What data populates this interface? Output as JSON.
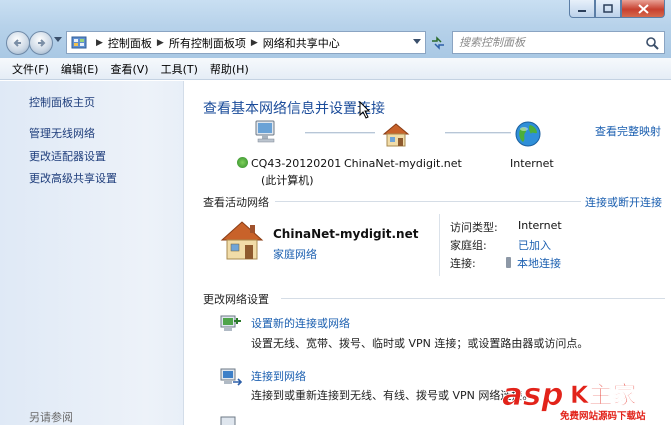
{
  "address": {
    "crumbs": [
      "控制面板",
      "所有控制面板项",
      "网络和共享中心"
    ],
    "search_placeholder": "搜索控制面板"
  },
  "menu": [
    "文件(F)",
    "编辑(E)",
    "查看(V)",
    "工具(T)",
    "帮助(H)"
  ],
  "sidebar": {
    "links": [
      "控制面板主页",
      "管理无线网络",
      "更改适配器设置",
      "更改高级共享设置"
    ],
    "see_also": "另请参阅"
  },
  "main": {
    "heading": "查看基本网络信息并设置连接",
    "view_full_map": "查看完整映射",
    "network_map": {
      "computer_name": "CQ43-20120201",
      "computer_sub": "(此计算机)",
      "network_name": "ChinaNet-mydigit.net",
      "internet": "Internet"
    },
    "active": {
      "header": "查看活动网络",
      "connect_disconnect": "连接或断开连接",
      "network_name": "ChinaNet-mydigit.net",
      "network_type": "家庭网络",
      "access_type_label": "访问类型:",
      "access_type_value": "Internet",
      "homegroup_label": "家庭组:",
      "homegroup_value": "已加入",
      "connection_label": "连接:",
      "connection_value": "本地连接"
    },
    "change": {
      "header": "更改网络设置",
      "tasks": [
        {
          "title": "设置新的连接或网络",
          "desc": "设置无线、宽带、拨号、临时或 VPN 连接；或设置路由器或访问点。"
        },
        {
          "title": "连接到网络",
          "desc": "连接到或重新连接到无线、有线、拨号或 VPN 网络连接。"
        }
      ]
    }
  },
  "watermark": {
    "brand": "asp",
    "suffix": "K主家",
    "sub": "免费网站源码下载站"
  }
}
